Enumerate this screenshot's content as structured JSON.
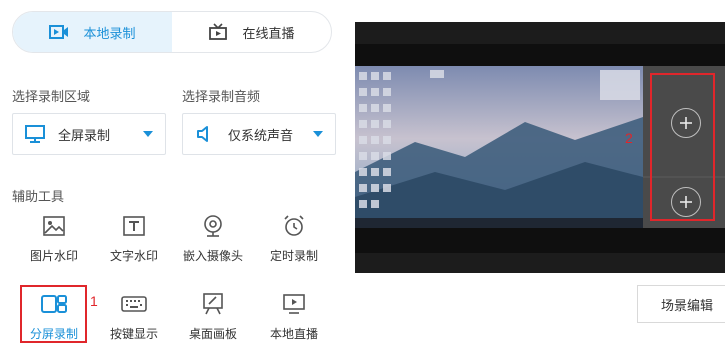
{
  "tabs": [
    {
      "label": "本地录制",
      "icon": "video-camera-icon",
      "active": true
    },
    {
      "label": "在线直播",
      "icon": "tv-icon",
      "active": false
    }
  ],
  "record_area": {
    "label": "选择录制区域",
    "value": "全屏录制",
    "icon": "monitor-icon"
  },
  "record_audio": {
    "label": "选择录制音频",
    "value": "仅系统声音",
    "icon": "speaker-icon"
  },
  "tools": {
    "label": "辅助工具",
    "items": [
      {
        "label": "图片水印",
        "icon": "image-icon"
      },
      {
        "label": "文字水印",
        "icon": "text-icon"
      },
      {
        "label": "嵌入摄像头",
        "icon": "webcam-icon"
      },
      {
        "label": "定时录制",
        "icon": "alarm-clock-icon"
      },
      {
        "label": "分屏录制",
        "icon": "split-screen-icon",
        "active": true
      },
      {
        "label": "按键显示",
        "icon": "keyboard-icon"
      },
      {
        "label": "桌面画板",
        "icon": "easel-icon"
      },
      {
        "label": "本地直播",
        "icon": "play-screen-icon"
      }
    ]
  },
  "annotations": [
    "1",
    "2"
  ],
  "scene_edit_label": "场景编辑",
  "colors": {
    "accent": "#1a90d8",
    "highlight": "#e0262b"
  }
}
